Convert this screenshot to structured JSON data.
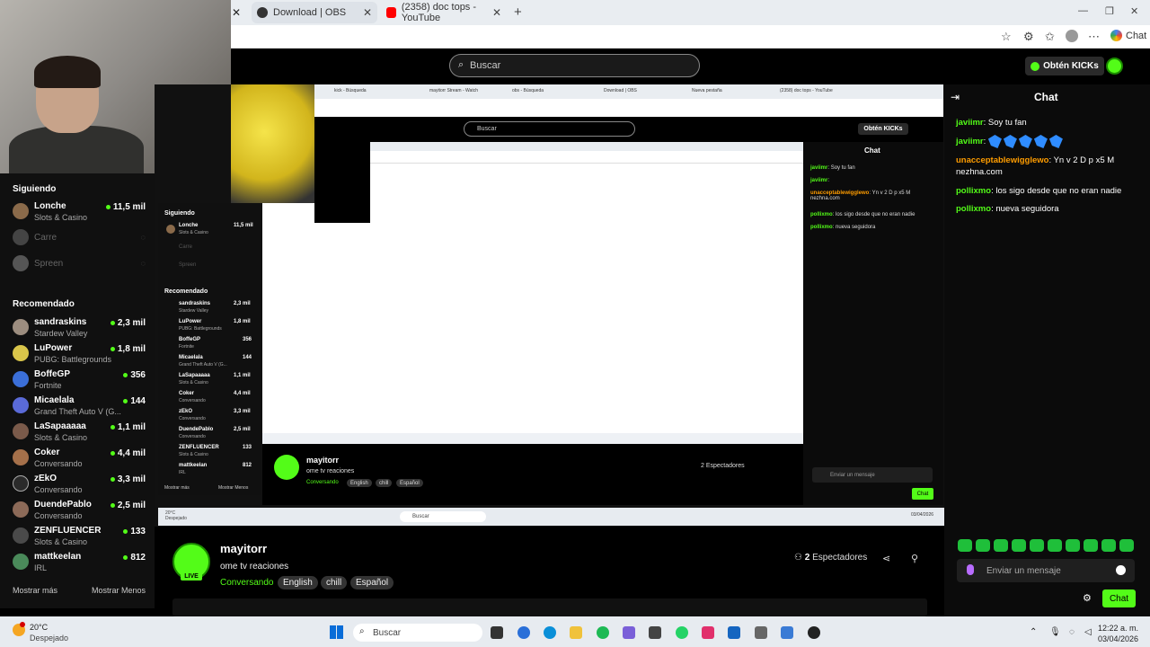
{
  "browser": {
    "tabs": [
      {
        "label": "Download | OBS",
        "active": true
      },
      {
        "label": "(2358) doc tops - YouTube",
        "active": false
      }
    ],
    "chat_chip": "Chat"
  },
  "header": {
    "search_placeholder": "Buscar",
    "kicks_button": "Obtén KICKs"
  },
  "sidebar": {
    "following_title": "Siguiendo",
    "following": [
      {
        "name": "Lonche",
        "game": "Slots & Casino",
        "viewers": "11,5 mil",
        "live": true
      },
      {
        "name": "Carre",
        "live": false
      },
      {
        "name": "Spreen",
        "live": false
      }
    ],
    "recommended_title": "Recomendado",
    "recommended": [
      {
        "name": "sandraskins",
        "game": "Stardew Valley",
        "viewers": "2,3 mil"
      },
      {
        "name": "LuPower",
        "game": "PUBG: Battlegrounds",
        "viewers": "1,8 mil"
      },
      {
        "name": "BoffeGP",
        "game": "Fortnite",
        "viewers": "356"
      },
      {
        "name": "Micaelala",
        "game": "Grand Theft Auto V (G...",
        "viewers": "144"
      },
      {
        "name": "LaSapaaaaa",
        "game": "Slots & Casino",
        "viewers": "1,1 mil"
      },
      {
        "name": "Coker",
        "game": "Conversando",
        "viewers": "4,4 mil"
      },
      {
        "name": "zEkO",
        "game": "Conversando",
        "viewers": "3,3 mil"
      },
      {
        "name": "DuendePablo",
        "game": "Conversando",
        "viewers": "2,5 mil"
      },
      {
        "name": "ZENFLUENCER",
        "game": "Slots & Casino",
        "viewers": "133"
      },
      {
        "name": "mattkeelan",
        "game": "IRL",
        "viewers": "812"
      }
    ],
    "show_more": "Mostrar más",
    "show_less": "Mostrar Menos"
  },
  "nested": {
    "tab_labels": [
      "kick - Búsqueda",
      "mayitorr Stream - Watch",
      "obs - Búsqueda",
      "Download | OBS",
      "Nueva pestaña",
      "(2358) doc tops - YouTube"
    ],
    "chat_title": "Chat",
    "message_placeholder": "Enviar un mensaje",
    "chat_button": "Chat",
    "spectators": "2 Espectadores",
    "weather_temp": "20°C",
    "weather_desc": "Despejado",
    "date": "03/04/2026"
  },
  "chat": {
    "title": "Chat",
    "messages": [
      {
        "user": "javiimr",
        "text": "Soy tu fan",
        "color": "#53fc18"
      },
      {
        "user": "javiimr",
        "text": "",
        "emotes": 5,
        "color": "#53fc18"
      },
      {
        "user": "unacceptablewigglewo",
        "text": "Yn v 2 D p x5 M nezhna.com",
        "color": "#ff9d00"
      },
      {
        "user": "pollixmo",
        "text": "los sigo desde que no eran nadie",
        "color": "#53fc18"
      },
      {
        "user": "pollixmo",
        "text": "nueva seguidora",
        "color": "#53fc18"
      }
    ],
    "input_placeholder": "Enviar un mensaje",
    "send_button": "Chat"
  },
  "stream": {
    "streamer": "mayitorr",
    "title": "ome tv reaciones",
    "category": "Conversando",
    "tags": [
      "English",
      "chill",
      "Español"
    ],
    "live_badge": "LIVE",
    "spectator_count": "2",
    "spectator_label": "Espectadores"
  },
  "taskbar": {
    "weather_temp": "20°C",
    "weather_desc": "Despejado",
    "search_placeholder": "Buscar",
    "time": "12:22 a. m.",
    "date": "03/04/2026"
  },
  "colors": {
    "kick_green": "#53fc18",
    "orange_user": "#ff9d00",
    "background": "#000000"
  }
}
